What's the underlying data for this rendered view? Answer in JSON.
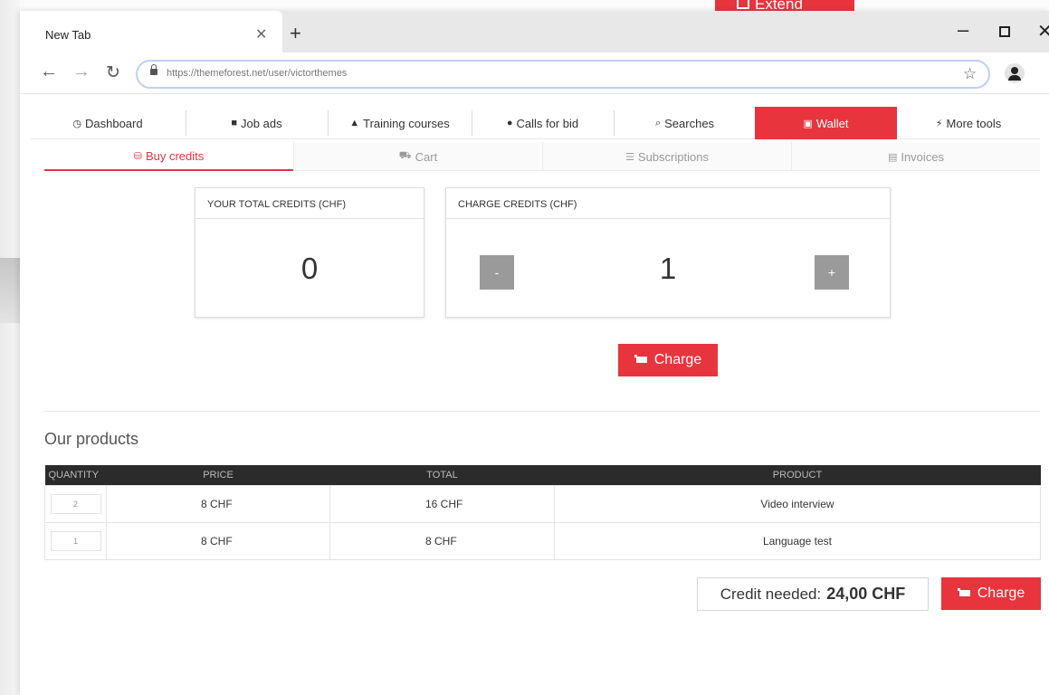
{
  "background": {
    "extend_label": "Extend"
  },
  "browser": {
    "tab_title": "New Tab",
    "url": "https://themeforest.net/user/victorthemes"
  },
  "main_nav": [
    {
      "label": "Dashboard",
      "icon": "dashboard-icon"
    },
    {
      "label": "Job ads",
      "icon": "briefcase-icon"
    },
    {
      "label": "Training courses",
      "icon": "graduation-cap-icon"
    },
    {
      "label": "Calls for bid",
      "icon": "binoculars-icon"
    },
    {
      "label": "Searches",
      "icon": "search-icon"
    },
    {
      "label": "Wallet",
      "icon": "wallet-icon",
      "active": true
    },
    {
      "label": "More tools",
      "icon": "bolt-icon"
    }
  ],
  "sub_nav": [
    {
      "label": "Buy credits",
      "icon": "coins-icon",
      "active": true
    },
    {
      "label": "Cart",
      "icon": "cart-icon"
    },
    {
      "label": "Subscriptions",
      "icon": "stack-icon"
    },
    {
      "label": "Invoices",
      "icon": "invoice-icon"
    }
  ],
  "total_credits": {
    "title": "YOUR TOTAL CREDITS (CHF)",
    "value": "0"
  },
  "charge_credits": {
    "title": "CHARGE CREDITS (CHF)",
    "value": "1",
    "minus": "-",
    "plus": "+"
  },
  "charge_button": "Charge",
  "products": {
    "title": "Our products",
    "headers": [
      "QUANTITY",
      "PRICE",
      "TOTAL",
      "PRODUCT"
    ],
    "rows": [
      {
        "quantity": "2",
        "price": "8 CHF",
        "total": "16 CHF",
        "product": "Video interview"
      },
      {
        "quantity": "1",
        "price": "8 CHF",
        "total": "8 CHF",
        "product": "Language test"
      }
    ]
  },
  "summary": {
    "label": "Credit needed:",
    "amount": "24,00 CHF",
    "charge_button": "Charge"
  },
  "colors": {
    "accent": "#e8343d",
    "table_header": "#2b2b2b"
  }
}
